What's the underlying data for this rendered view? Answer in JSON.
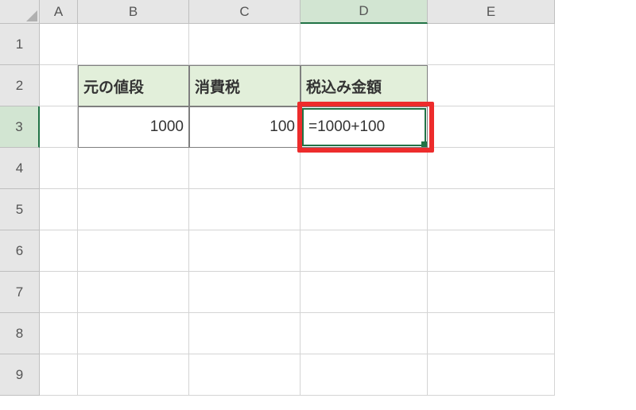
{
  "columns": [
    "A",
    "B",
    "C",
    "D",
    "E"
  ],
  "rows": [
    "1",
    "2",
    "3",
    "4",
    "5",
    "6",
    "7",
    "8",
    "9"
  ],
  "selected_column": "D",
  "selected_row": "3",
  "headers": {
    "B2": "元の値段",
    "C2": "消費税",
    "D2": "税込み金額"
  },
  "values": {
    "B3": "1000",
    "C3": "100"
  },
  "editing": {
    "cell": "D3",
    "formula": "=1000+100"
  },
  "chart_data": {
    "type": "table",
    "columns": [
      "元の値段",
      "消費税",
      "税込み金額"
    ],
    "rows": [
      {
        "元の値段": 1000,
        "消費税": 100,
        "税込み金額": "=1000+100"
      }
    ]
  }
}
